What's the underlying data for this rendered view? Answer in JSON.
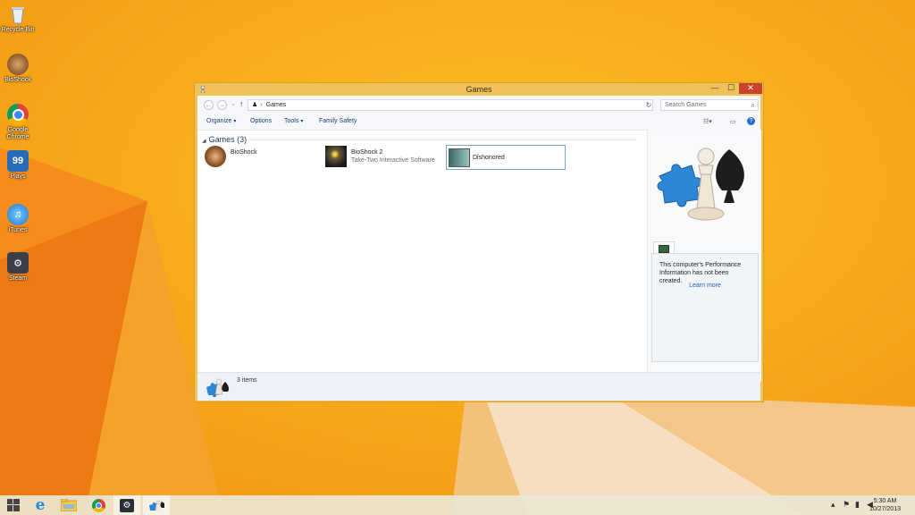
{
  "desktop": {
    "icons": [
      {
        "label": "Recycle Bin",
        "icon": "recycle-bin-icon"
      },
      {
        "label": "BioShock",
        "icon": "bioshock-icon"
      },
      {
        "label": "Google Chrome",
        "icon": "chrome-icon"
      },
      {
        "label": "Plays",
        "icon": "plays-icon"
      },
      {
        "label": "iTunes",
        "icon": "itunes-icon"
      },
      {
        "label": "Steam",
        "icon": "steam-icon"
      }
    ]
  },
  "window": {
    "title": "Games",
    "controls": {
      "minimize": "—",
      "maximize": "☐",
      "close": "✕"
    },
    "address": {
      "crumb": "Games",
      "search_placeholder": "Search Games"
    },
    "toolbar": {
      "organize": "Organize",
      "options": "Options",
      "tools": "Tools",
      "family_safety": "Family Safety"
    },
    "group_header": "Games (3)",
    "games": [
      {
        "name": "BioShock",
        "publisher": ""
      },
      {
        "name": "BioShock 2",
        "publisher": "Take-Two Interactive Software"
      },
      {
        "name": "Dishonored",
        "publisher": ""
      }
    ],
    "details_pane": {
      "message": "This computer's Performance Information has not been created.",
      "link": "Learn more"
    },
    "status": {
      "count": "3 items"
    }
  },
  "taskbar": {
    "items": [
      "start-icon",
      "internet-explorer-icon",
      "file-explorer-icon",
      "chrome-icon",
      "steam-icon",
      "games-icon"
    ],
    "clock": {
      "time": "5:30 AM",
      "date": "10/27/2013"
    }
  },
  "colors": {
    "accent": "#f0c35a",
    "close": "#c7432e",
    "link": "#1f5fa8",
    "wallpaper": "#f6a21c"
  }
}
